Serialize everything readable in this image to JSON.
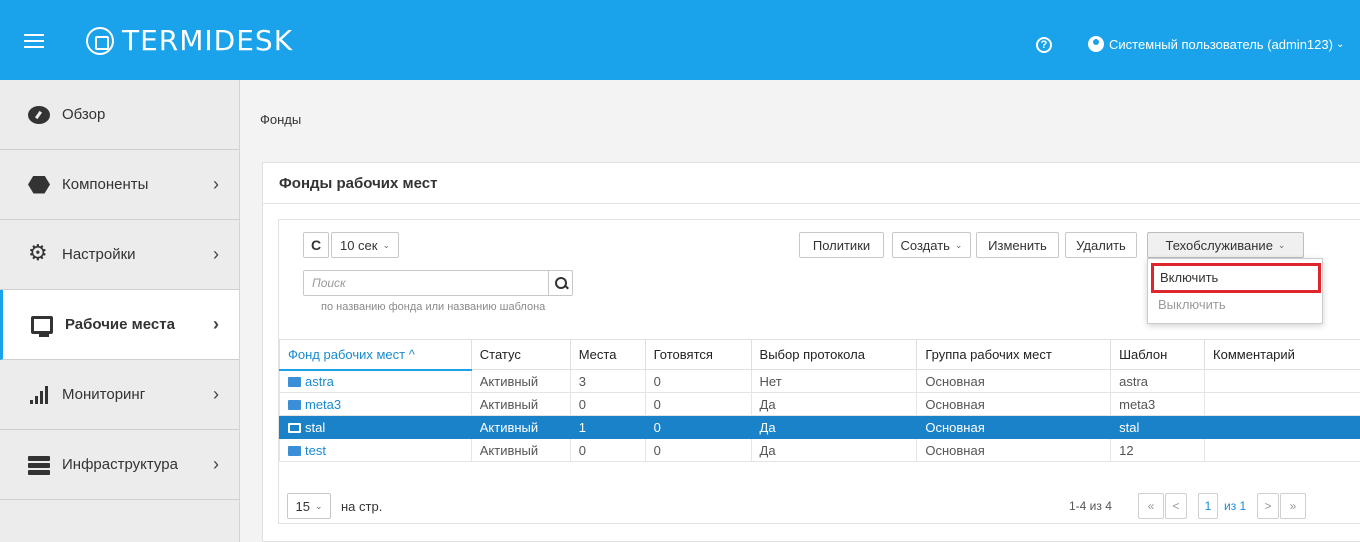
{
  "header": {
    "brand": "TERMIDESK",
    "user": "Системный пользователь (admin123)",
    "help_icon": "question-circle-icon",
    "user_icon": "user-circle-icon",
    "bg_color": "#1aa3ea"
  },
  "sidebar": {
    "items": [
      {
        "label": "Обзор",
        "icon": "dashboard-icon"
      },
      {
        "label": "Компоненты",
        "icon": "cubes-icon"
      },
      {
        "label": "Настройки",
        "icon": "cogs-icon"
      },
      {
        "label": "Рабочие места",
        "icon": "desktop-icon"
      },
      {
        "label": "Мониторинг",
        "icon": "signal-icon"
      },
      {
        "label": "Инфраструктура",
        "icon": "server-icon"
      }
    ]
  },
  "breadcrumb": "Фонды",
  "panel": {
    "title": "Фонды рабочих мест"
  },
  "toolbar": {
    "refresh_icon": "refresh-icon",
    "interval": "10 сек",
    "policies": "Политики",
    "create": "Создать",
    "edit": "Изменить",
    "delete": "Удалить",
    "maintenance": "Техобслуживание"
  },
  "search": {
    "placeholder": "Поиск",
    "hint": "по названию фонда или названию шаблона"
  },
  "maintenance_menu": {
    "enable": "Включить",
    "disable": "Выключить"
  },
  "table": {
    "columns": [
      "Фонд рабочих мест ^",
      "Статус",
      "Места",
      "Готовятся",
      "Выбор протокола",
      "Группа рабочих мест",
      "Шаблон",
      "Комментарий"
    ],
    "rows": [
      {
        "name": "astra",
        "status": "Активный",
        "places": "3",
        "preparing": "0",
        "protocol": "Нет",
        "group": "Основная",
        "template": "astra",
        "comment": ""
      },
      {
        "name": "meta3",
        "status": "Активный",
        "places": "0",
        "preparing": "0",
        "protocol": "Да",
        "group": "Основная",
        "template": "meta3",
        "comment": ""
      },
      {
        "name": "stal",
        "status": "Активный",
        "places": "1",
        "preparing": "0",
        "protocol": "Да",
        "group": "Основная",
        "template": "stal",
        "comment": ""
      },
      {
        "name": "test",
        "status": "Активный",
        "places": "0",
        "preparing": "0",
        "protocol": "Да",
        "group": "Основная",
        "template": "12",
        "comment": ""
      }
    ],
    "selected_row": 2
  },
  "pagination": {
    "per_page": "15",
    "per_page_label": "на стр.",
    "range": "1-4 из 4",
    "first": "«",
    "prev": "<",
    "page": "1",
    "of_pages": "из 1",
    "next": ">",
    "last": "»"
  }
}
